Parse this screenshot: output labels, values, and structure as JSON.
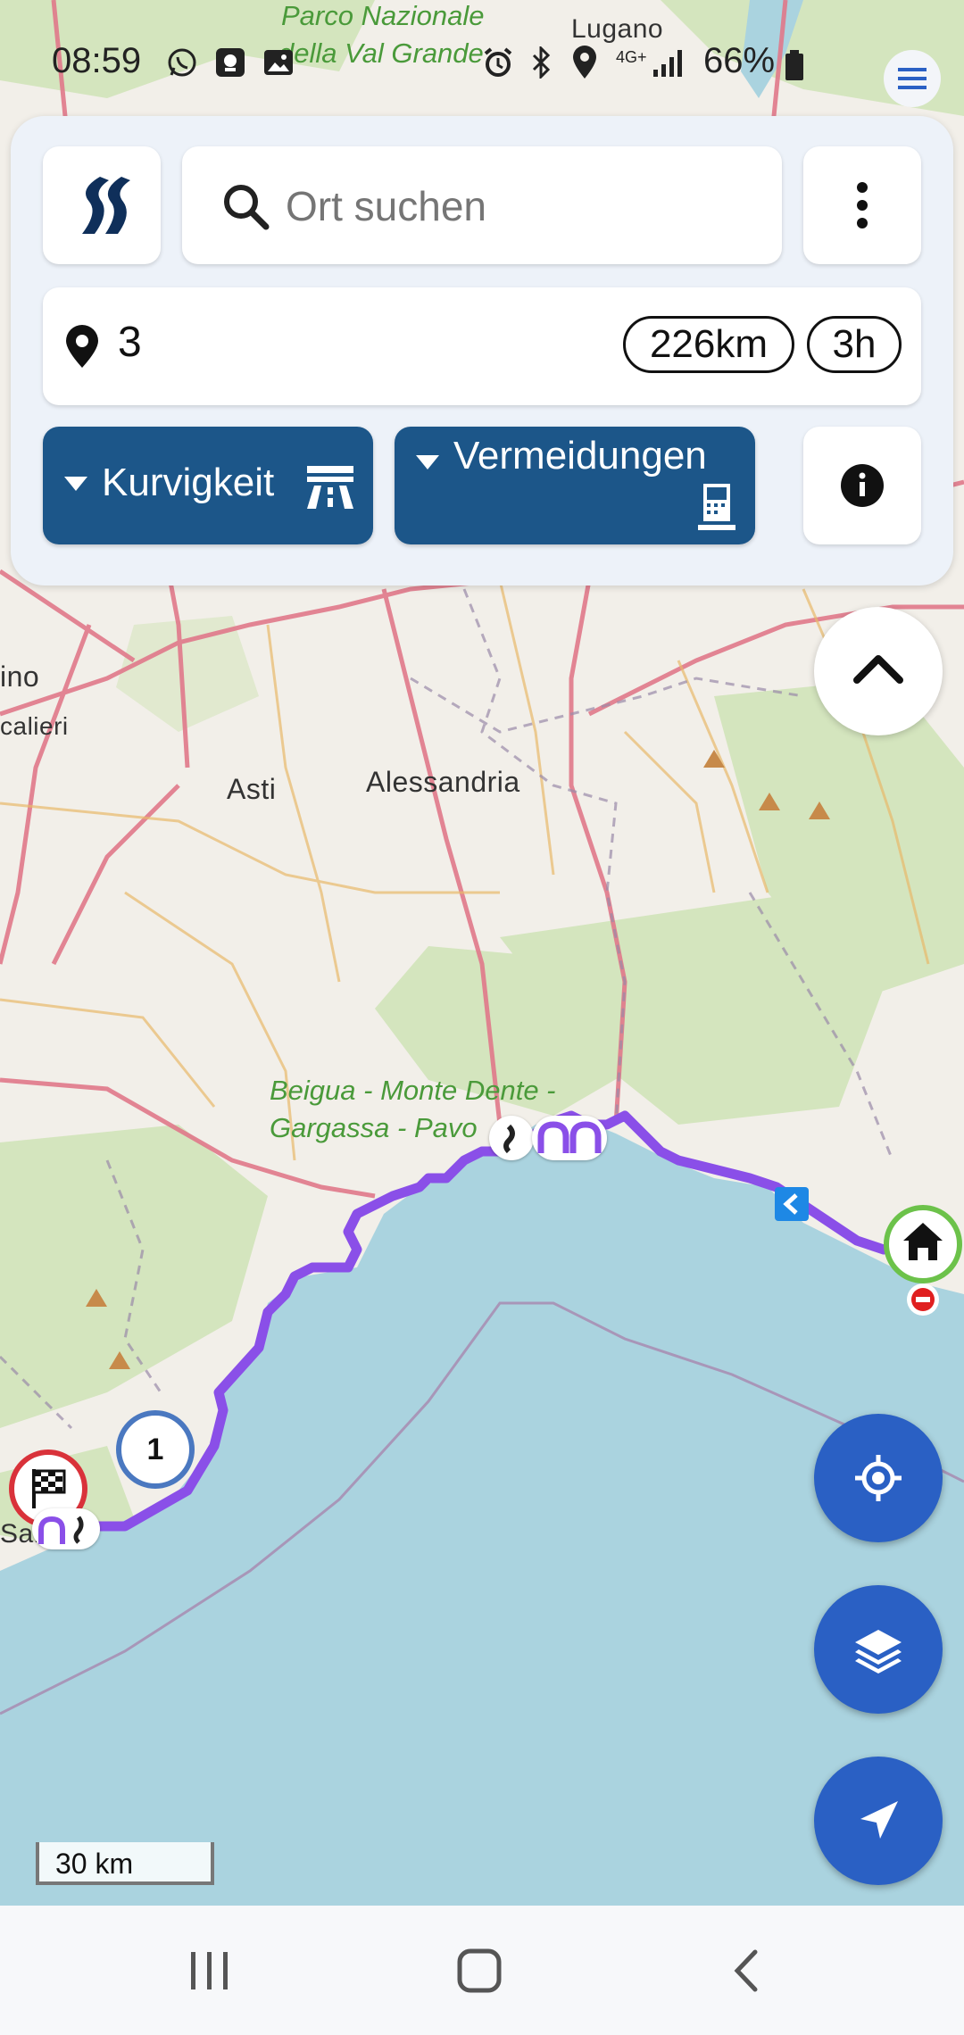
{
  "status_bar": {
    "time": "08:59",
    "battery": "66%",
    "network": "4G+"
  },
  "map": {
    "labels": {
      "lugano": "Lugano",
      "asti": "Asti",
      "alessandria": "Alessandria",
      "ino": "ino",
      "calieri": "calieri",
      "san": "San",
      "park_top_1": "Parco Nazionale",
      "park_top_2": "della Val Grande",
      "park_beigua_1": "Beigua - Monte Dente -",
      "park_beigua_2": "Gargassa - Pavo"
    },
    "waypoint_number": "1",
    "scale_label": "30 km"
  },
  "panel": {
    "search_placeholder": "Ort suchen",
    "waypoint_count": "3",
    "distance": "226km",
    "duration": "3h",
    "curviness_label": "Kurvigkeit",
    "avoidances_label": "Vermeidungen"
  },
  "colors": {
    "accent_blue": "#1c5689",
    "fab_blue": "#2a60c4",
    "route": "#8a4fe8",
    "sea": "#aad3df"
  },
  "icons": [
    "app-logo-icon",
    "search-icon",
    "more-vert-icon",
    "map-pin-icon",
    "motorway-icon",
    "toll-icon",
    "info-icon",
    "chevron-up-icon",
    "my-location-icon",
    "layers-icon",
    "navigate-icon",
    "menu-icon",
    "home-icon",
    "finish-flag-icon"
  ]
}
